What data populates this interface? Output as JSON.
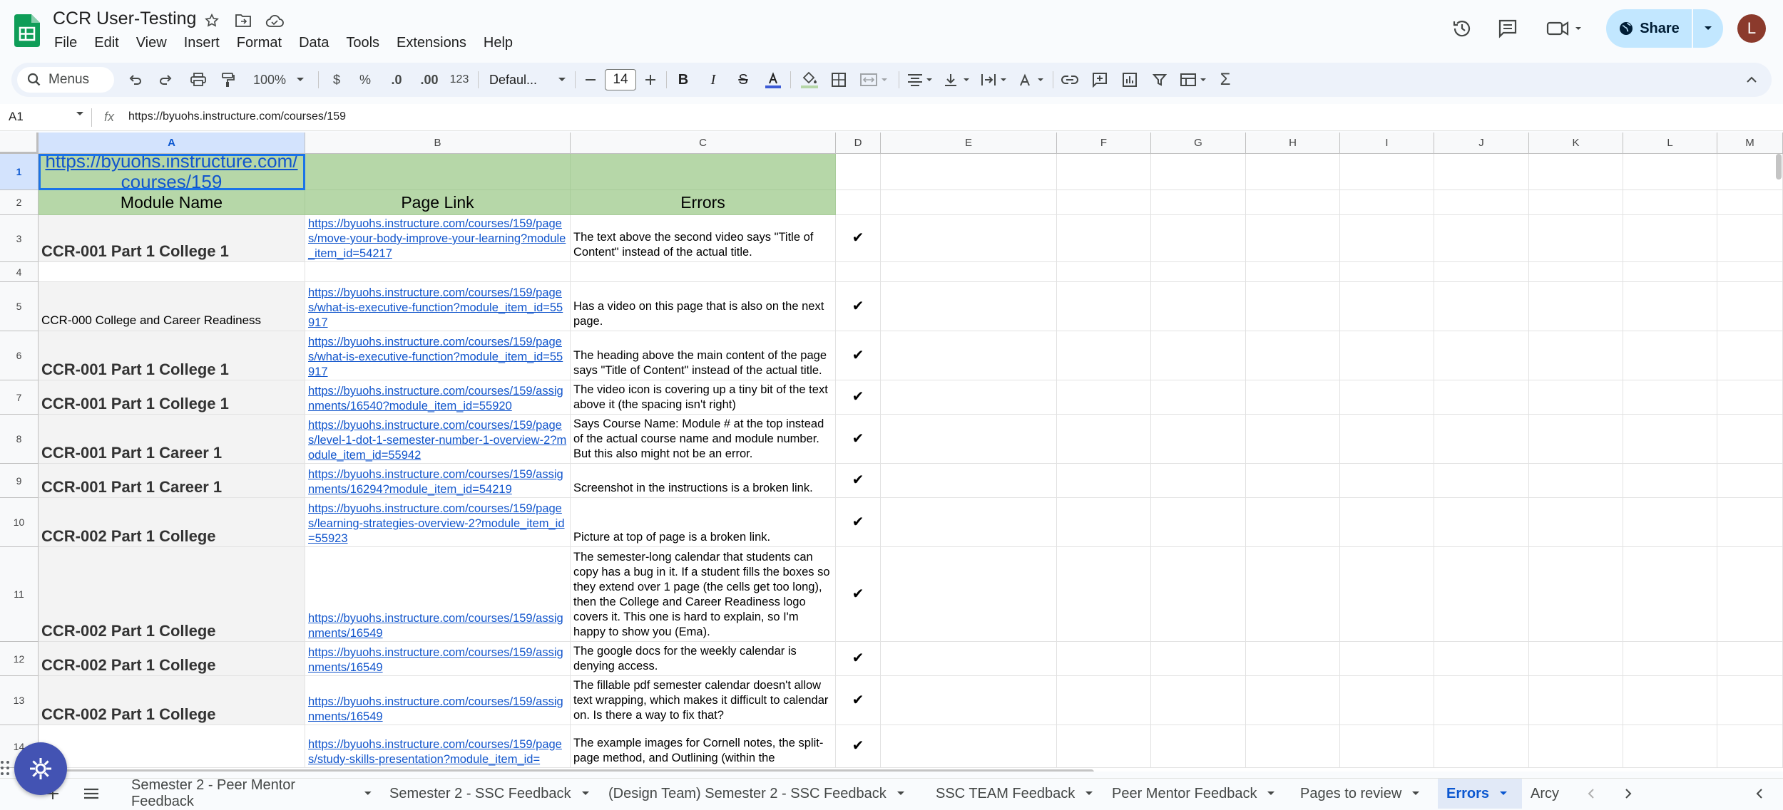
{
  "doc": {
    "title": "CCR User-Testing"
  },
  "menu": [
    "File",
    "Edit",
    "View",
    "Insert",
    "Format",
    "Data",
    "Tools",
    "Extensions",
    "Help"
  ],
  "share": {
    "label": "Share"
  },
  "user": {
    "initial": "L"
  },
  "toolbar": {
    "menus_label": "Menus",
    "zoom": "100%",
    "currency": "$",
    "percent": "%",
    "dec_decrease": ".0",
    "dec_increase": ".00",
    "number_format": "123",
    "font": "Defaul...",
    "font_size": "14"
  },
  "formula_bar": {
    "cell_ref": "A1",
    "fx": "fx",
    "content": "https://byuohs.instructure.com/courses/159"
  },
  "columns": [
    "A",
    "B",
    "C",
    "D",
    "E",
    "F",
    "G",
    "H",
    "I",
    "J",
    "K",
    "L",
    "M"
  ],
  "rows": [
    {
      "num": "1",
      "a": "https://byuohs.instructure.com/courses/159",
      "b": "",
      "c": "",
      "d": ""
    },
    {
      "num": "2",
      "a": "Module Name",
      "b": "Page Link",
      "c": "Errors",
      "d": ""
    },
    {
      "num": "3",
      "a": "CCR-001 Part 1 College 1",
      "b": "https://byuohs.instructure.com/courses/159/pages/move-your-body-improve-your-learning?module_item_id=54217",
      "c": "The text above the second video says \"Title of Content\" instead of the actual title.",
      "d": "✔"
    },
    {
      "num": "4",
      "a": "",
      "b": "",
      "c": "",
      "d": ""
    },
    {
      "num": "5",
      "a": "CCR-000 College and Career Readiness",
      "b": "https://byuohs.instructure.com/courses/159/pages/what-is-executive-function?module_item_id=55917",
      "c": "Has a video on this page that is also on the next page.",
      "d": "✔"
    },
    {
      "num": "6",
      "a": "CCR-001 Part 1 College 1",
      "b": "https://byuohs.instructure.com/courses/159/pages/what-is-executive-function?module_item_id=55917",
      "c": "The heading above the main content of the page says \"Title of Content\" instead of the actual title.",
      "d": "✔"
    },
    {
      "num": "7",
      "a": "CCR-001 Part 1 College 1",
      "b": "https://byuohs.instructure.com/courses/159/assignments/16540?module_item_id=55920",
      "c": "The video icon is covering up a tiny bit of the text above it (the spacing isn't right)",
      "d": "✔"
    },
    {
      "num": "8",
      "a": "CCR-001 Part 1 Career 1",
      "b": "https://byuohs.instructure.com/courses/159/pages/level-1-dot-1-semester-number-1-overview-2?module_item_id=55942",
      "c": "Says Course Name: Module # at the top instead of the actual course name and module number. But this also might not be an error.",
      "d": "✔"
    },
    {
      "num": "9",
      "a": "CCR-001 Part 1 Career 1",
      "b": "https://byuohs.instructure.com/courses/159/assignments/16294?module_item_id=54219",
      "c": "Screenshot in the instructions is a broken link.",
      "d": "✔"
    },
    {
      "num": "10",
      "a": "CCR-002 Part 1 College",
      "b": "https://byuohs.instructure.com/courses/159/pages/learning-strategies-overview-2?module_item_id=55923",
      "c": "Picture at top of page is a broken link.",
      "d": "✔"
    },
    {
      "num": "11",
      "a": "CCR-002 Part 1 College",
      "b": "https://byuohs.instructure.com/courses/159/assignments/16549",
      "c": "The semester-long calendar that students can copy has a bug in it. If a student fills the boxes so they extend over 1 page (the cells get too long), then the College and Career Readiness logo covers it. This one is hard to explain, so I'm happy to show you (Ema).",
      "d": "✔"
    },
    {
      "num": "12",
      "a": "CCR-002 Part 1 College",
      "b": "https://byuohs.instructure.com/courses/159/assignments/16549",
      "c": "The google docs for the weekly calendar is denying access.",
      "d": "✔"
    },
    {
      "num": "13",
      "a": "CCR-002 Part 1 College",
      "b": "https://byuohs.instructure.com/courses/159/assignments/16549",
      "c": "The fillable pdf semester calendar doesn't allow text wrapping, which makes it difficult to calendar on. Is there a way to fix that?",
      "d": "✔"
    },
    {
      "num": "14",
      "a": "",
      "b": "https://byuohs.instructure.com/courses/159/pages/study-skills-presentation?module_item_id=",
      "c": "The example images for Cornell notes, the split-page method, and Outlining (within the",
      "d": "✔"
    }
  ],
  "sheets": [
    "Semester 2 - Peer Mentor Feedback",
    "Semester 2 - SSC Feedback",
    "(Design Team) Semester 2 - SSC Feedback",
    "SSC TEAM Feedback",
    "Peer Mentor Feedback",
    "Pages to review",
    "Errors",
    "Arcy"
  ],
  "active_sheet": "Errors",
  "colors": {
    "header_green": "#b6d7a8",
    "link": "#1155cc",
    "accent": "#0b57d0",
    "share_bg": "#c2e7ff"
  }
}
